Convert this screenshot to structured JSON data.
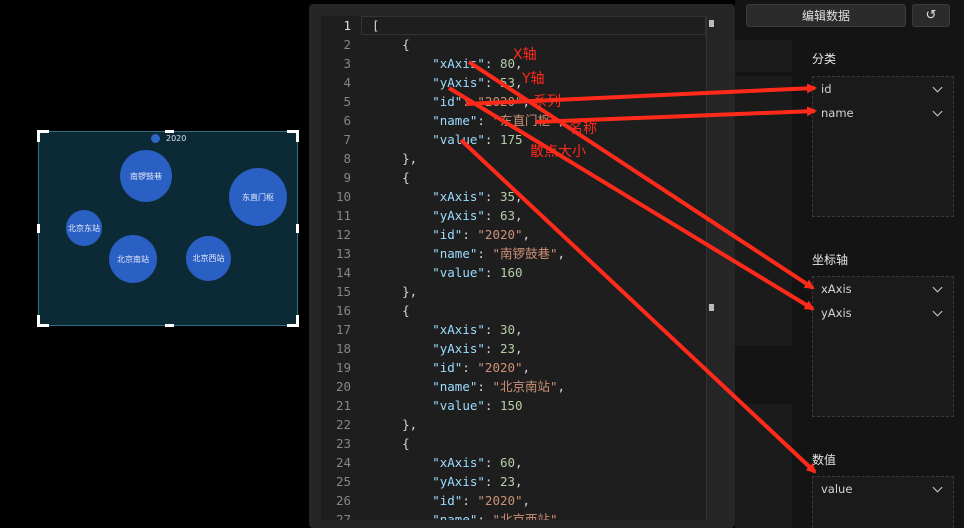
{
  "chart": {
    "legend_label": "2020",
    "bubbles": [
      {
        "name": "南锣鼓巷"
      },
      {
        "name": "东直门枢"
      },
      {
        "name": "北京东站"
      },
      {
        "name": "北京南站"
      },
      {
        "name": "北京西站"
      }
    ]
  },
  "editor": {
    "lines": [
      "[",
      "    {",
      "        \"xAxis\": 80,",
      "        \"yAxis\": 53,",
      "        \"id\": \"2020\",",
      "        \"name\": \"东直门枢\",",
      "        \"value\": 175",
      "    },",
      "    {",
      "        \"xAxis\": 35,",
      "        \"yAxis\": 63,",
      "        \"id\": \"2020\",",
      "        \"name\": \"南锣鼓巷\",",
      "        \"value\": 160",
      "    },",
      "    {",
      "        \"xAxis\": 30,",
      "        \"yAxis\": 23,",
      "        \"id\": \"2020\",",
      "        \"name\": \"北京南站\",",
      "        \"value\": 150",
      "    },",
      "    {",
      "        \"xAxis\": 60,",
      "        \"yAxis\": 23,",
      "        \"id\": \"2020\",",
      "        \"name\": \"北京西站\","
    ]
  },
  "panel": {
    "edit_data_label": "编辑数据",
    "reset_icon": "↺",
    "sections": [
      {
        "title": "分类",
        "fields": [
          "id",
          "name"
        ]
      },
      {
        "title": "坐标轴",
        "fields": [
          "xAxis",
          "yAxis"
        ]
      },
      {
        "title": "数值",
        "fields": [
          "value"
        ]
      }
    ]
  },
  "annotations": {
    "labels": [
      "X轴",
      "Y轴",
      "系列",
      "名称",
      "散点大小"
    ],
    "color": "#ff2a1a"
  },
  "colors": {
    "bubble": "#2a5fc4",
    "chart_bg": "#0c2a35",
    "json_key": "#9cdcfe",
    "json_string": "#ce9178",
    "json_number": "#b5cea8"
  }
}
